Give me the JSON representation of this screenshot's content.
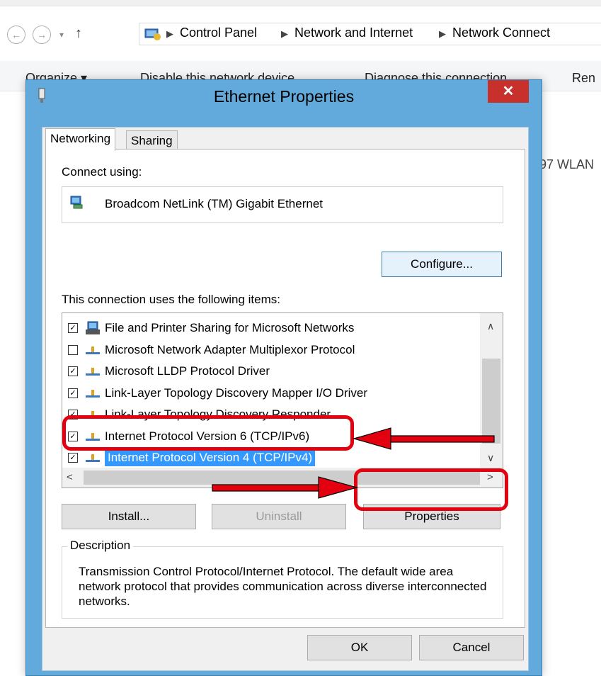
{
  "explorer": {
    "breadcrumb": [
      "Control Panel",
      "Network and Internet",
      "Network Connect"
    ],
    "commands": [
      "Organize ▾",
      "Disable this network device",
      "Diagnose this connection",
      "Ren"
    ],
    "bg_adapter_text": "97 WLAN"
  },
  "dialog": {
    "title": "Ethernet Properties",
    "close_glyph": "✕",
    "tabs": [
      "Networking",
      "Sharing"
    ],
    "connect_using_label": "Connect using:",
    "adapter_name": "Broadcom NetLink (TM) Gigabit Ethernet",
    "configure_label": "Configure...",
    "items_label": "This connection uses the following items:",
    "items": [
      {
        "label": "File and Printer Sharing for Microsoft Networks",
        "checked": true,
        "icon": "printer-sharing-icon"
      },
      {
        "label": "Microsoft Network Adapter Multiplexor Protocol",
        "checked": false,
        "icon": "network-protocol-icon"
      },
      {
        "label": "Microsoft LLDP Protocol Driver",
        "checked": true,
        "icon": "network-protocol-icon"
      },
      {
        "label": "Link-Layer Topology Discovery Mapper I/O Driver",
        "checked": true,
        "icon": "network-protocol-icon"
      },
      {
        "label": "Link-Layer Topology Discovery Responder",
        "checked": true,
        "icon": "network-protocol-icon"
      },
      {
        "label": "Internet Protocol Version 6 (TCP/IPv6)",
        "checked": true,
        "icon": "network-protocol-icon"
      },
      {
        "label": "Internet Protocol Version 4 (TCP/IPv4)",
        "checked": true,
        "icon": "network-protocol-icon",
        "selected": true
      }
    ],
    "install_label": "Install...",
    "uninstall_label": "Uninstall",
    "properties_label": "Properties",
    "description_legend": "Description",
    "description_text": "Transmission Control Protocol/Internet Protocol. The default wide area network protocol that provides communication across diverse interconnected networks.",
    "ok_label": "OK",
    "cancel_label": "Cancel"
  },
  "colors": {
    "annotation_red": "#e3000f",
    "selection_blue": "#3399ff",
    "title_bar": "#62a9dc",
    "close_red": "#c7302b"
  }
}
